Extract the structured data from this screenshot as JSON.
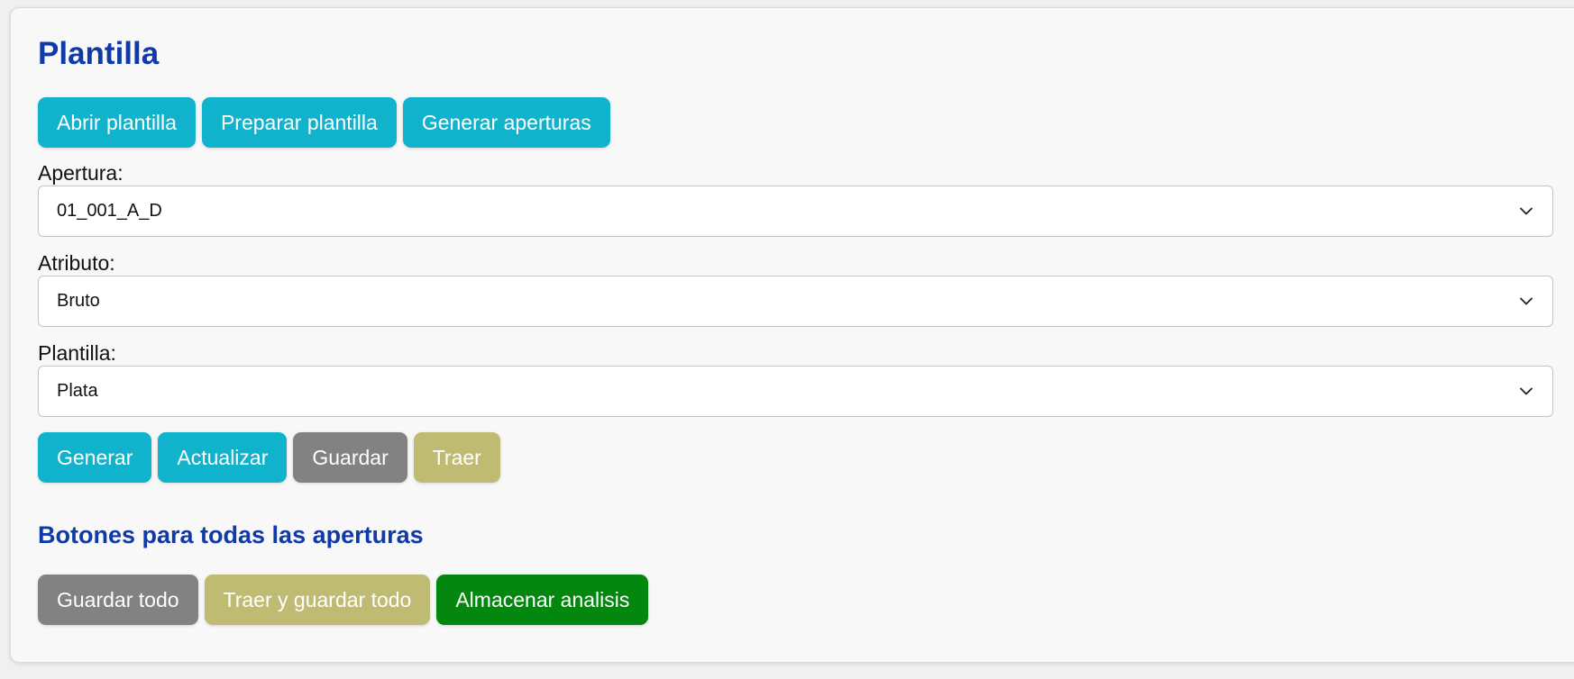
{
  "panel": {
    "title": "Plantilla"
  },
  "top_buttons": {
    "abrir": "Abrir plantilla",
    "preparar": "Preparar plantilla",
    "generar_aperturas": "Generar aperturas"
  },
  "fields": {
    "apertura": {
      "label": "Apertura:",
      "value": "01_001_A_D"
    },
    "atributo": {
      "label": "Atributo:",
      "value": "Bruto"
    },
    "plantilla": {
      "label": "Plantilla:",
      "value": "Plata"
    }
  },
  "action_buttons": {
    "generar": "Generar",
    "actualizar": "Actualizar",
    "guardar": "Guardar",
    "traer": "Traer"
  },
  "all_section": {
    "title": "Botones para todas las aperturas",
    "guardar_todo": "Guardar todo",
    "traer_guardar_todo": "Traer y guardar todo",
    "almacenar": "Almacenar analisis"
  },
  "colors": {
    "accent_blue": "#10b2cc",
    "title_blue": "#0f3aa8",
    "gray": "#828282",
    "olive": "#c0bb72",
    "green": "#04870e"
  },
  "icons": {
    "select_indicator": "chevron-down-icon"
  }
}
